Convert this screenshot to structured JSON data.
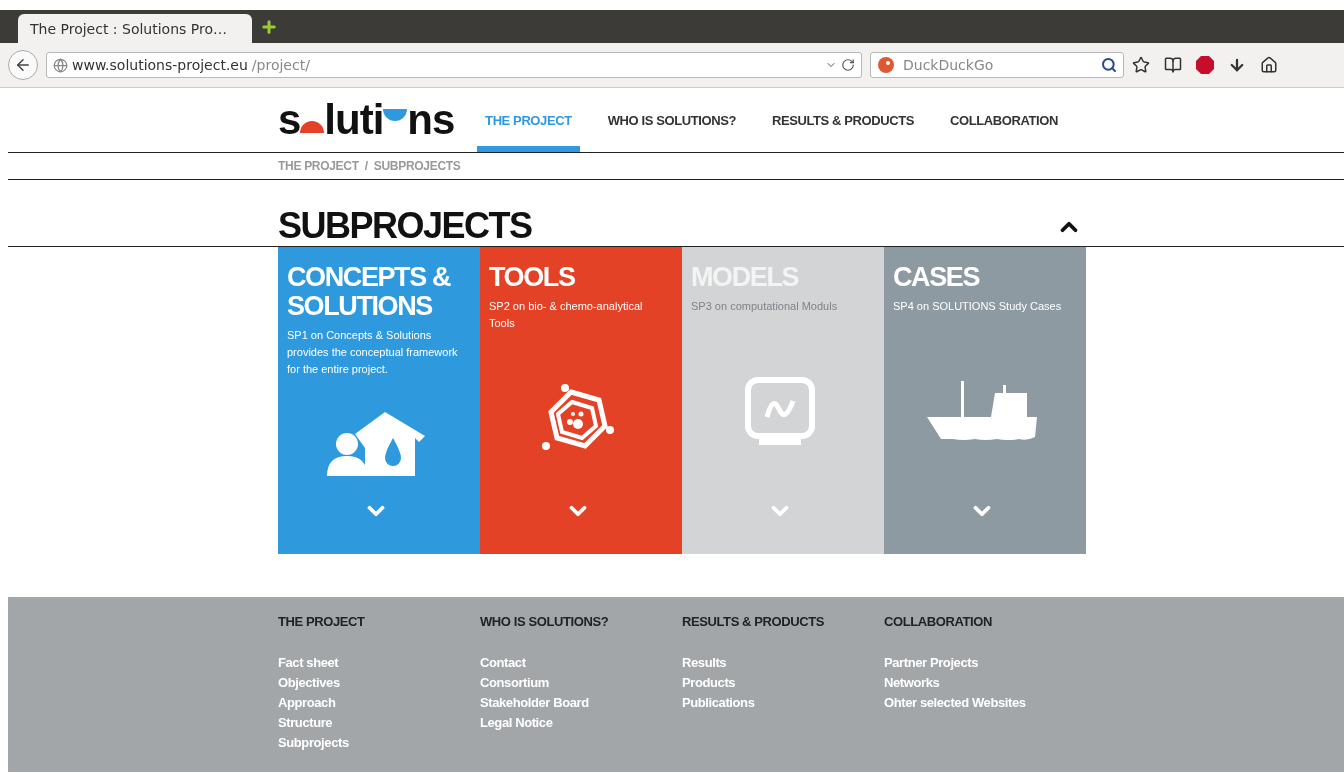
{
  "browser": {
    "tab_title": "The Project : Solutions Pro…",
    "url_host": "www.solutions-project.eu",
    "url_path": "/project/",
    "search_placeholder": "DuckDuckGo"
  },
  "logo": {
    "parts": [
      "s",
      "luti",
      "ns"
    ]
  },
  "nav": [
    {
      "label": "THE PROJECT",
      "selected": true
    },
    {
      "label": "WHO IS SOLUTIONS?",
      "selected": false
    },
    {
      "label": "RESULTS & PRODUCTS",
      "selected": false
    },
    {
      "label": "COLLABORATION",
      "selected": false
    }
  ],
  "breadcrumb": [
    "THE PROJECT",
    "SUBPROJECTS"
  ],
  "breadcrumb_separator": "/",
  "heading": "SUBPROJECTS",
  "tiles": [
    {
      "title": "CONCEPTS & SOLUTIONS",
      "text": "SP1 on Concepts & Solutions provides the conceptual framework for the entire project.",
      "color": "#2e99dc",
      "kind": "house"
    },
    {
      "title": "TOOLS",
      "text": "SP2 on bio- & chemo-analytical Tools",
      "color": "#e34226",
      "kind": "molecule"
    },
    {
      "title": "MODELS",
      "text": "SP3 on computational Moduls",
      "color": "#d3d4d6",
      "kind": "monitor"
    },
    {
      "title": "CASES",
      "text": "SP4 on SOLUTIONS Study Cases",
      "color": "#8e9aa2",
      "kind": "boat"
    }
  ],
  "footer": [
    {
      "heading": "THE PROJECT",
      "links": [
        "Fact sheet",
        "Objectives",
        "Approach",
        "Structure",
        "Subprojects"
      ]
    },
    {
      "heading": "WHO IS SOLUTIONS?",
      "links": [
        "Contact",
        "Consortium",
        "Stakeholder Board",
        "Legal Notice"
      ]
    },
    {
      "heading": "RESULTS & PRODUCTS",
      "links": [
        "Results",
        "Products",
        "Publications"
      ]
    },
    {
      "heading": "COLLABORATION",
      "links": [
        "Partner Projects",
        "Networks",
        "Ohter selected Websites"
      ]
    }
  ]
}
